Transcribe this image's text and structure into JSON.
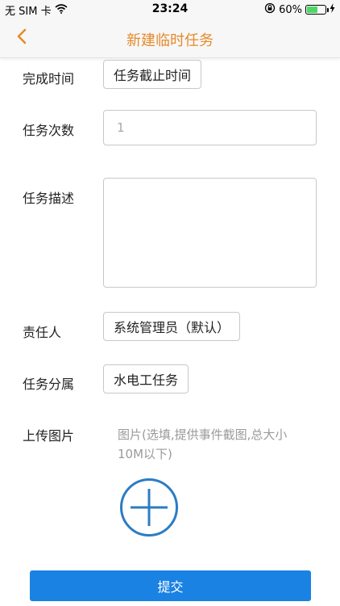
{
  "status_bar": {
    "carrier": "无 SIM 卡",
    "time": "23:24",
    "battery": "60%",
    "battery_level": 0.6
  },
  "nav": {
    "title": "新建临时任务"
  },
  "form": {
    "finish_time": {
      "label": "完成时间",
      "value": "任务截止时间"
    },
    "task_count": {
      "label": "任务次数",
      "placeholder": "1"
    },
    "task_desc": {
      "label": "任务描述"
    },
    "responsible": {
      "label": "责任人",
      "value": "系统管理员（默认）"
    },
    "category": {
      "label": "任务分属",
      "value": "水电工任务"
    },
    "upload": {
      "label": "上传图片",
      "hint": "图片(选填,提供事件截图,总大小10M以下)"
    }
  },
  "submit": {
    "label": "提交"
  },
  "colors": {
    "accent_orange": "#e78a2a",
    "submit_blue": "#1a82e3",
    "add_icon_blue": "#2c7cc3",
    "battery_green": "#4cd964"
  }
}
